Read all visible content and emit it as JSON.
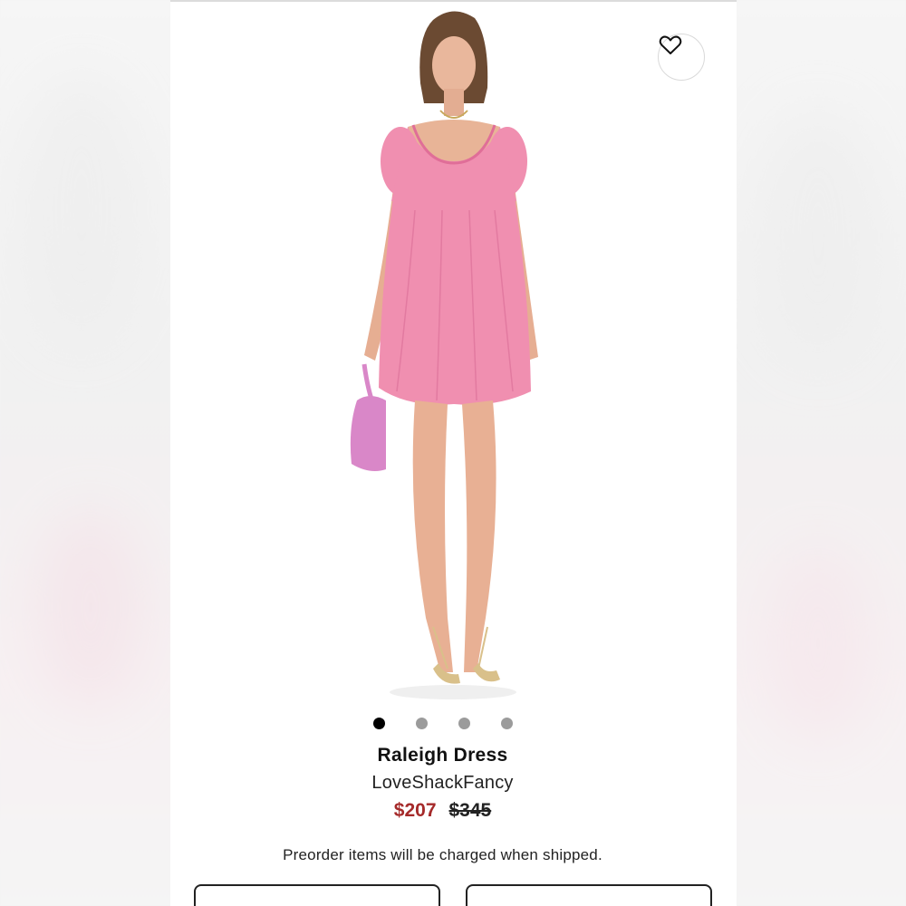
{
  "product": {
    "title": "Raleigh Dress",
    "brand": "LoveShackFancy",
    "sale_price": "$207",
    "original_price": "$345"
  },
  "notice": "Preorder items will be charged when shipped.",
  "carousel": {
    "total": 4,
    "active": 1
  },
  "icons": {
    "favorite": "heart-icon"
  },
  "colors": {
    "sale_price": "#a52a2a",
    "dress": "#f08fb0",
    "bag": "#d987c8",
    "dot_active": "#000000",
    "dot_inactive": "#9b9b9b"
  }
}
